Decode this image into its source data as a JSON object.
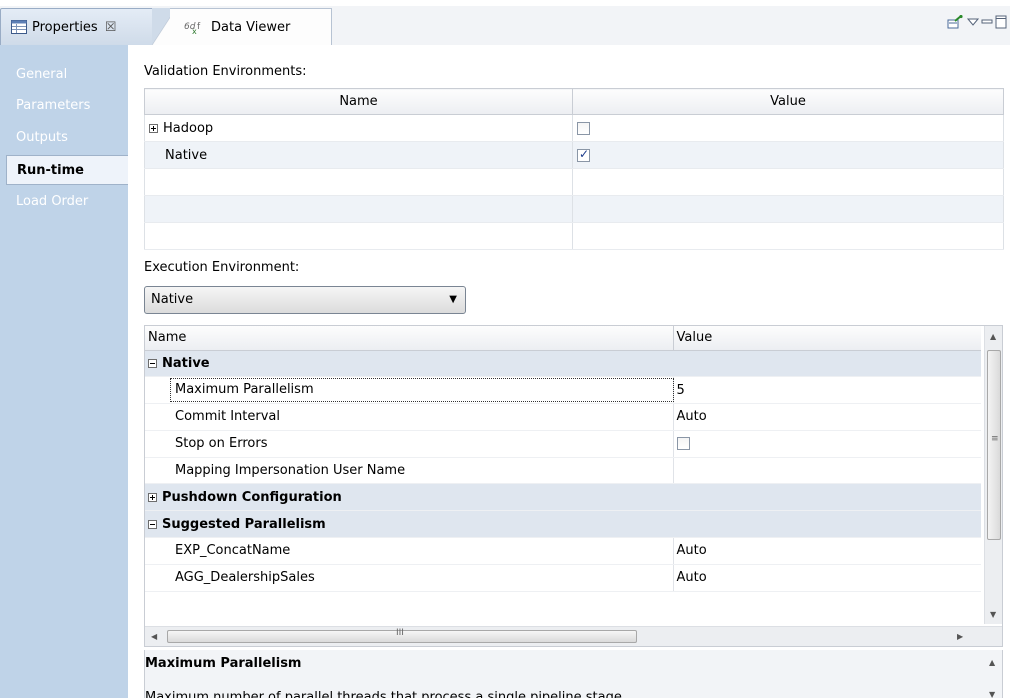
{
  "tabs": {
    "properties_label": "Properties",
    "close_glyph": "☒",
    "data_viewer_label": "Data Viewer"
  },
  "nav": {
    "items": [
      {
        "label": "General"
      },
      {
        "label": "Parameters"
      },
      {
        "label": "Outputs"
      },
      {
        "label": "Run-time"
      },
      {
        "label": "Load Order"
      }
    ],
    "selected": "Run-time"
  },
  "validation": {
    "label": "Validation Environments:",
    "col_name": "Name",
    "col_value": "Value",
    "rows": [
      {
        "name": "Hadoop",
        "checked": false,
        "expandable": true
      },
      {
        "name": "Native",
        "checked": true,
        "expandable": false
      }
    ]
  },
  "execution": {
    "label": "Execution Environment:",
    "selected": "Native"
  },
  "properties": {
    "col_name": "Name",
    "col_value": "Value",
    "rows": [
      {
        "type": "category",
        "name": "Native",
        "expanded": true
      },
      {
        "type": "prop",
        "name": "Maximum Parallelism",
        "value": "5",
        "focused": true
      },
      {
        "type": "prop",
        "name": "Commit Interval",
        "value": "Auto"
      },
      {
        "type": "prop",
        "name": "Stop on Errors",
        "value": "",
        "checkbox": true
      },
      {
        "type": "prop",
        "name": "Mapping Impersonation User Name",
        "value": ""
      },
      {
        "type": "category",
        "name": "Pushdown Configuration",
        "expanded": false
      },
      {
        "type": "category",
        "name": "Suggested Parallelism",
        "expanded": true
      },
      {
        "type": "prop",
        "name": "EXP_ConcatName",
        "value": "Auto"
      },
      {
        "type": "prop",
        "name": "AGG_DealershipSales",
        "value": "Auto"
      }
    ],
    "hscroll_grip": "III",
    "vscroll_grip": "≡"
  },
  "description": {
    "title": "Maximum Parallelism",
    "text": "Maximum number of parallel threads that process a single pipeline stage."
  },
  "colors": {
    "nav_bg": "#bfd3e8",
    "category_bg": "#dfe6ef",
    "alt_row_bg": "#eff3f8"
  }
}
